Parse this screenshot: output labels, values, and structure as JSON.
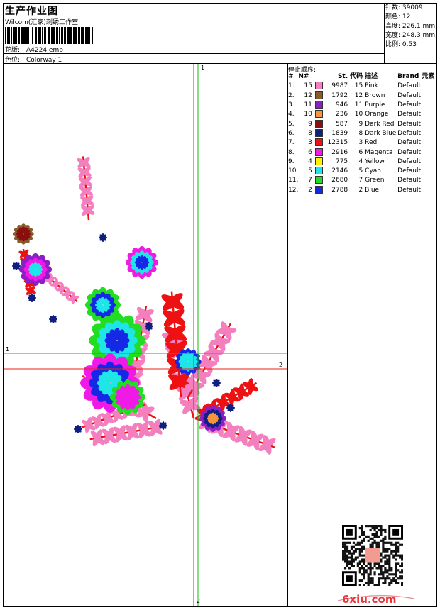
{
  "header": {
    "title": "生产作业图",
    "studio": "Wilcom(汇家)刺绣工作室",
    "design_label": "花版:",
    "design_value": "A4224.emb",
    "colorway_label": "色位:",
    "colorway_value": "Colorway 1"
  },
  "stats": [
    {
      "label": "针数",
      "value": "39009"
    },
    {
      "label": "颜色",
      "value": "12"
    },
    {
      "label": "高度",
      "value": "226.1 mm"
    },
    {
      "label": "宽度",
      "value": "248.3 mm"
    },
    {
      "label": "比例",
      "value": "0.53"
    }
  ],
  "stop_sequence": {
    "title": "停止顺序:",
    "headers": [
      "#",
      "N#",
      "",
      "St.",
      "代码",
      "描述",
      "Brand",
      "元素"
    ],
    "rows": [
      {
        "idx": "1.",
        "n": "15",
        "color": "#F47FBF",
        "st": "9987",
        "code": "15",
        "desc": "Pink",
        "brand": "Default"
      },
      {
        "idx": "2.",
        "n": "12",
        "color": "#8B5A2B",
        "st": "1792",
        "code": "12",
        "desc": "Brown",
        "brand": "Default"
      },
      {
        "idx": "3.",
        "n": "11",
        "color": "#8B1FC4",
        "st": "946",
        "code": "11",
        "desc": "Purple",
        "brand": "Default"
      },
      {
        "idx": "4.",
        "n": "10",
        "color": "#F7943F",
        "st": "236",
        "code": "10",
        "desc": "Orange",
        "brand": "Default"
      },
      {
        "idx": "5.",
        "n": "9",
        "color": "#8B0F0F",
        "st": "587",
        "code": "9",
        "desc": "Dark Red",
        "brand": "Default"
      },
      {
        "idx": "6.",
        "n": "8",
        "color": "#0F1F80",
        "st": "1839",
        "code": "8",
        "desc": "Dark Blue",
        "brand": "Default"
      },
      {
        "idx": "7.",
        "n": "3",
        "color": "#EE1111",
        "st": "12315",
        "code": "3",
        "desc": "Red",
        "brand": "Default"
      },
      {
        "idx": "8.",
        "n": "6",
        "color": "#F019E6",
        "st": "2916",
        "code": "6",
        "desc": "Magenta",
        "brand": "Default"
      },
      {
        "idx": "9.",
        "n": "4",
        "color": "#FFF200",
        "st": "775",
        "code": "4",
        "desc": "Yellow",
        "brand": "Default"
      },
      {
        "idx": "10.",
        "n": "5",
        "color": "#1FE6E6",
        "st": "2146",
        "code": "5",
        "desc": "Cyan",
        "brand": "Default"
      },
      {
        "idx": "11.",
        "n": "7",
        "color": "#22DD22",
        "st": "2680",
        "code": "7",
        "desc": "Green",
        "brand": "Default"
      },
      {
        "idx": "12.",
        "n": "2",
        "color": "#1428E6",
        "st": "2788",
        "code": "2",
        "desc": "Blue",
        "brand": "Default"
      }
    ]
  },
  "axis_labels": {
    "green_v": "1",
    "green_h": "1",
    "red_h": "2",
    "red_v": "2"
  },
  "watermark": {
    "logo_text": "6xiu.com",
    "logo_color": "#E8383D"
  }
}
